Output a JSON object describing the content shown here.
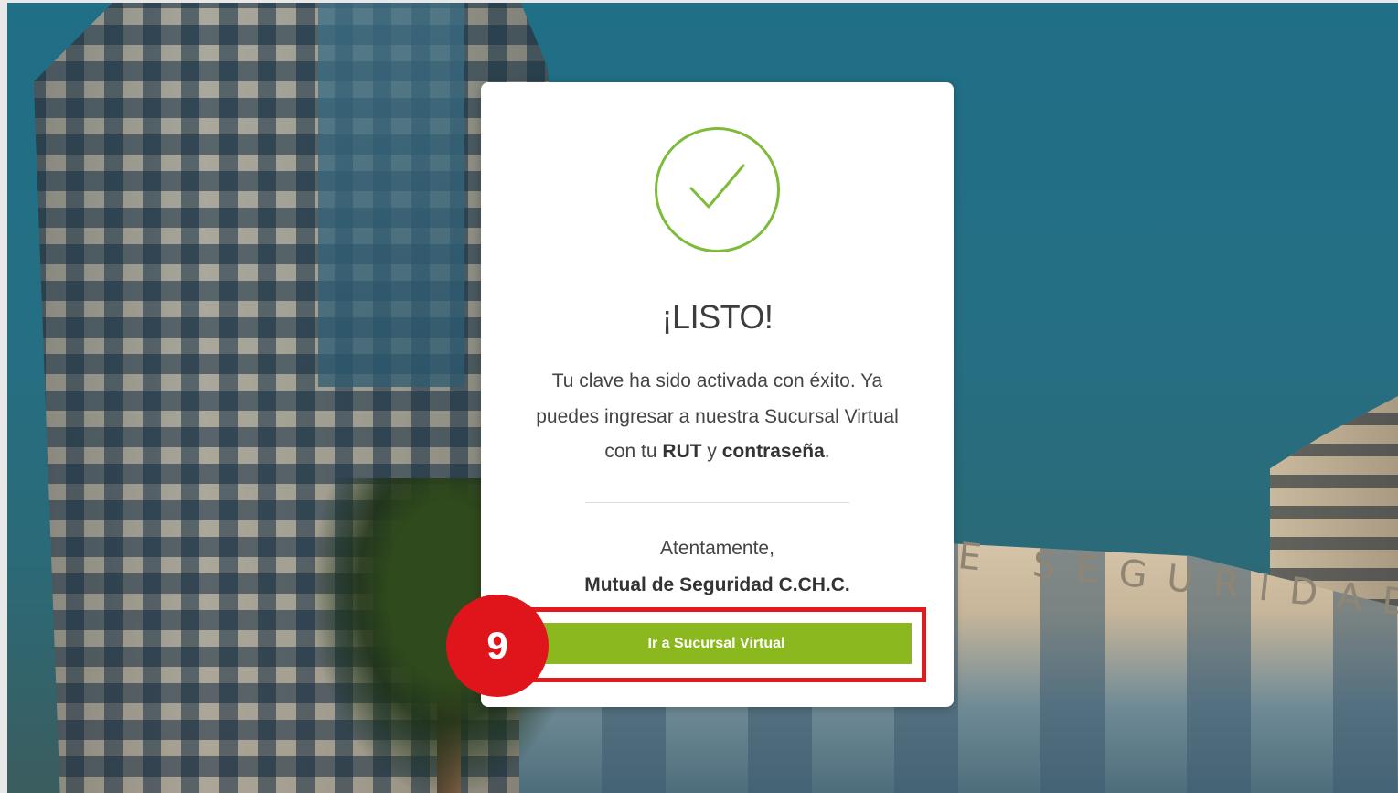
{
  "background": {
    "sign_text": "E SEGURIDAD"
  },
  "card": {
    "icon": "check-circle-icon",
    "title": "¡LISTO!",
    "message_part1": "Tu clave ha sido activada con éxito. Ya puedes ingresar a nuestra Sucursal Virtual con tu ",
    "message_rut": "RUT",
    "message_part2": " y ",
    "message_password": "contraseña",
    "message_part3": ".",
    "regards": "Atentamente,",
    "signature": "Mutual de Seguridad C.CH.C.",
    "button_label": "Ir a Sucursal Virtual"
  },
  "annotation": {
    "step_number": "9"
  },
  "colors": {
    "accent_green": "#8ab81e",
    "check_green": "#7dbb3a",
    "annotation_red": "#e41a1a"
  }
}
